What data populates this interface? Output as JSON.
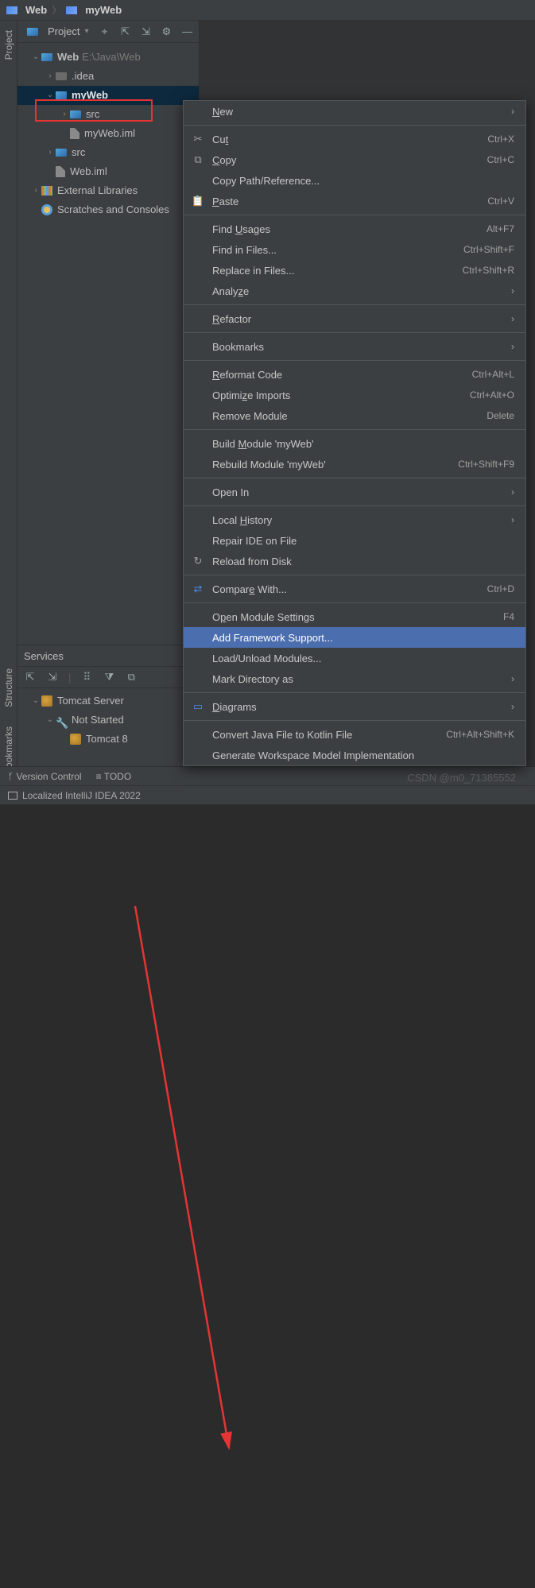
{
  "breadcrumb": {
    "root": "Web",
    "current": "myWeb"
  },
  "projectPanel": {
    "title": "Project",
    "tree": {
      "root": {
        "name": "Web",
        "path": "E:\\Java\\Web"
      },
      "idea": ".idea",
      "myWeb": "myWeb",
      "myWebSrc": "src",
      "myWebIml": "myWeb.iml",
      "src": "src",
      "webIml": "Web.iml",
      "extLibs": "External Libraries",
      "scratches": "Scratches and Consoles"
    }
  },
  "services": {
    "title": "Services",
    "tomcat": "Tomcat Server",
    "notStarted": "Not Started",
    "tomcat8": "Tomcat 8"
  },
  "contextMenu": {
    "new": "New",
    "cut": "Cut",
    "cut_sc": "Ctrl+X",
    "copy": "Copy",
    "copy_sc": "Ctrl+C",
    "copyPath": "Copy Path/Reference...",
    "paste": "Paste",
    "paste_sc": "Ctrl+V",
    "findUsages": "Find Usages",
    "findUsages_sc": "Alt+F7",
    "findInFiles": "Find in Files...",
    "findInFiles_sc": "Ctrl+Shift+F",
    "replaceInFiles": "Replace in Files...",
    "replaceInFiles_sc": "Ctrl+Shift+R",
    "analyze": "Analyze",
    "refactor": "Refactor",
    "bookmarks": "Bookmarks",
    "reformat": "Reformat Code",
    "reformat_sc": "Ctrl+Alt+L",
    "optimize": "Optimize Imports",
    "optimize_sc": "Ctrl+Alt+O",
    "removeModule": "Remove Module",
    "removeModule_sc": "Delete",
    "buildModule": "Build Module 'myWeb'",
    "rebuildModule": "Rebuild Module 'myWeb'",
    "rebuildModule_sc": "Ctrl+Shift+F9",
    "openIn": "Open In",
    "localHistory": "Local History",
    "repairIDE": "Repair IDE on File",
    "reloadDisk": "Reload from Disk",
    "compare": "Compare With...",
    "compare_sc": "Ctrl+D",
    "openModuleSettings": "Open Module Settings",
    "openModuleSettings_sc": "F4",
    "addFramework": "Add Framework Support...",
    "loadUnload": "Load/Unload Modules...",
    "markDir": "Mark Directory as",
    "diagrams": "Diagrams",
    "convertKotlin": "Convert Java File to Kotlin File",
    "convertKotlin_sc": "Ctrl+Alt+Shift+K",
    "genWorkspace": "Generate Workspace Model Implementation"
  },
  "leftGutter": {
    "project": "Project",
    "structure": "Structure",
    "bookmarks": "Bookmarks"
  },
  "statusBar": {
    "vcs": "Version Control",
    "todo": "TODO",
    "msg": "Localized IntelliJ IDEA 2022"
  },
  "watermark": "CSDN @m0_71385552"
}
